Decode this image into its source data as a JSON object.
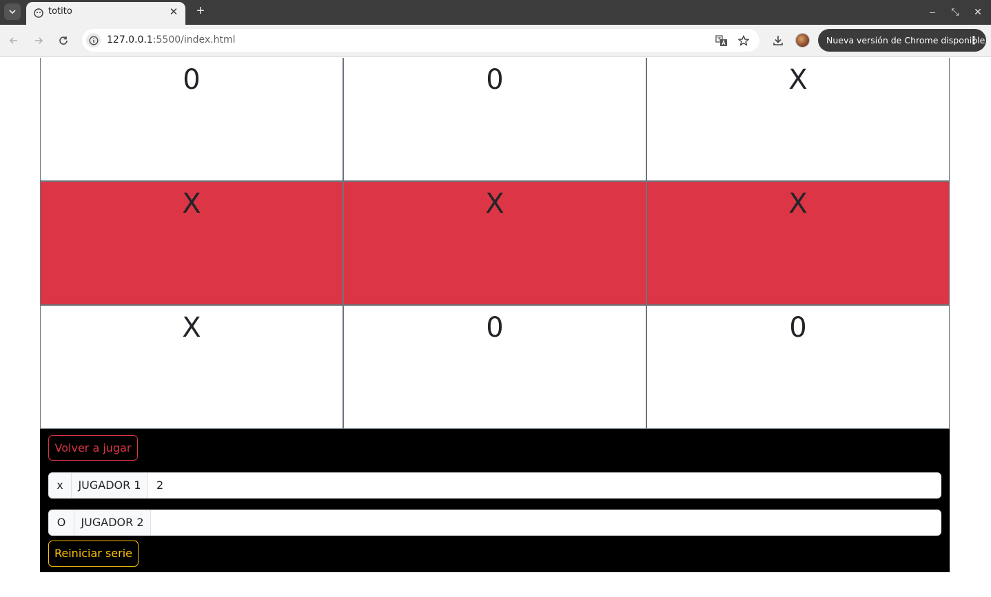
{
  "browser": {
    "tab_title": "totito",
    "tab_close": "✕",
    "new_tab": "+",
    "url_host": "127.0.0.1",
    "url_rest": ":5500/index.html",
    "update_label": "Nueva versión de Chrome disponible",
    "window_controls": {
      "minimize": "–",
      "restore": "⤡",
      "close": "✕"
    }
  },
  "board": {
    "cells": [
      {
        "mark": "0",
        "winning": false
      },
      {
        "mark": "0",
        "winning": false
      },
      {
        "mark": "X",
        "winning": false
      },
      {
        "mark": "X",
        "winning": true
      },
      {
        "mark": "X",
        "winning": true
      },
      {
        "mark": "X",
        "winning": true
      },
      {
        "mark": "X",
        "winning": false
      },
      {
        "mark": "0",
        "winning": false
      },
      {
        "mark": "0",
        "winning": false
      }
    ],
    "win_color": "#dc3545"
  },
  "controls": {
    "play_again_label": "Volver a jugar",
    "reset_series_label": "Reiniciar serie"
  },
  "players": [
    {
      "symbol": "x",
      "name": "JUGADOR 1",
      "score": "2"
    },
    {
      "symbol": "O",
      "name": "JUGADOR 2",
      "score": ""
    }
  ],
  "colors": {
    "danger": "#dc3545",
    "warning": "#ffc107",
    "panel_bg": "#000000"
  }
}
